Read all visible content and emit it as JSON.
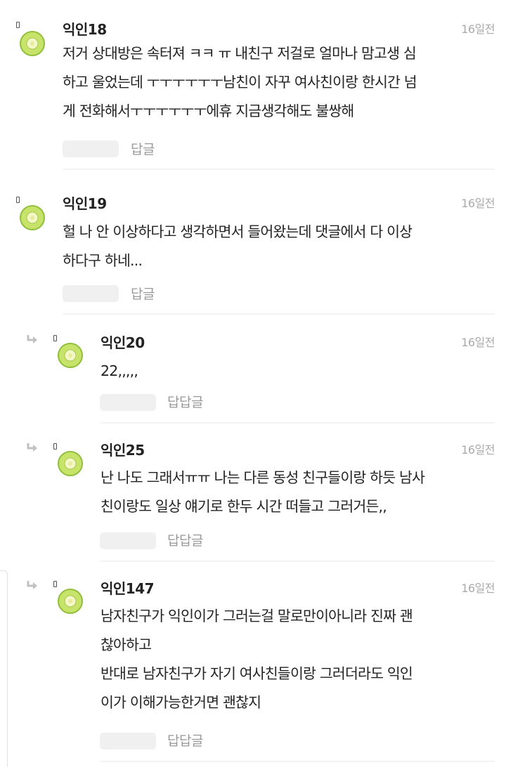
{
  "comments": [
    {
      "name": "익인18",
      "time": "16일전",
      "lines": [
        "저거 상대방은 속터져 ㅋㅋ ㅠ 내친구 저걸로 얼마나 맘고생 심",
        "하고 울었는데 ㅜㅜㅜㅜㅜㅜ남친이 자꾸 여사친이랑 한시간 넘",
        "게 전화해서ㅜㅜㅜㅜㅜㅜ에휴 지금생각해도 불쌍해"
      ],
      "reply_label": "답글"
    },
    {
      "name": "익인19",
      "time": "16일전",
      "lines": [
        "헐 나 안 이상하다고 생각하면서 들어왔는데 댓글에서 다 이상",
        "하다구 하네..."
      ],
      "reply_label": "답글"
    },
    {
      "name": "익인20",
      "time": "16일전",
      "lines": [
        "22,,,,,"
      ],
      "reply_label": "답답글"
    },
    {
      "name": "익인25",
      "time": "16일전",
      "lines": [
        "난 나도 그래서ㅠㅠ 나는 다른 동성 친구들이랑 하듯 남사",
        "친이랑도 일상 얘기로 한두 시간 떠들고 그러거든,,"
      ],
      "reply_label": "답답글"
    },
    {
      "name": "익인147",
      "time": "16일전",
      "lines": [
        "남자친구가 익인이가 그러는걸 말로만이아니라 진짜 괜",
        "찮아하고",
        "반대로 남자친구가 자기 여사친들이랑 그러더라도 익인",
        "이가 이해가능한거면 괜찮지"
      ],
      "reply_label": "답답글"
    }
  ],
  "icons": {
    "avatar": "kiwi-avatar-icon",
    "reply_indicator": "reply-arrow-icon",
    "marker": "comment-marker-icon"
  },
  "colors": {
    "avatar_ring": "#8fbf3a",
    "avatar_fill": "#c7e36a",
    "avatar_core": "#f4f7c8",
    "reply_arrow": "#c0c0c0",
    "muted_text": "#aaaaaa"
  }
}
